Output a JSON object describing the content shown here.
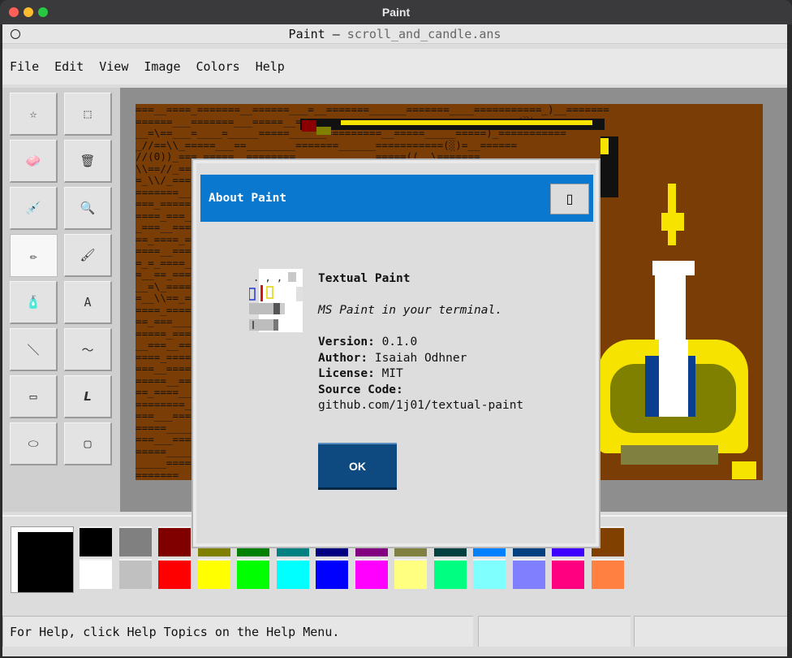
{
  "os_window": {
    "title": "Paint"
  },
  "app": {
    "title_main": "Paint — ",
    "title_file": "scroll_and_candle.ans"
  },
  "menu": [
    "File",
    "Edit",
    "View",
    "Image",
    "Colors",
    "Help"
  ],
  "tools": [
    {
      "name": "free-form-select",
      "glyph": "☆"
    },
    {
      "name": "rect-select",
      "glyph": "⬚"
    },
    {
      "name": "eraser",
      "glyph": "🧼"
    },
    {
      "name": "fill-bucket",
      "glyph": "🗑"
    },
    {
      "name": "pick-color",
      "glyph": "💉"
    },
    {
      "name": "magnifier",
      "glyph": "🔍"
    },
    {
      "name": "pencil",
      "glyph": "✏"
    },
    {
      "name": "brush",
      "glyph": "🖌"
    },
    {
      "name": "airbrush",
      "glyph": "🧴"
    },
    {
      "name": "text",
      "glyph": "A"
    },
    {
      "name": "line",
      "glyph": "＼"
    },
    {
      "name": "curve",
      "glyph": "～"
    },
    {
      "name": "rectangle",
      "glyph": "▭"
    },
    {
      "name": "polygon",
      "glyph": "𝙇"
    },
    {
      "name": "ellipse",
      "glyph": "⬭"
    },
    {
      "name": "rounded-rectangle",
      "glyph": "▢"
    }
  ],
  "palette": {
    "top": [
      "#000000",
      "#808080",
      "#800000",
      "#808000",
      "#008000",
      "#008080",
      "#000080",
      "#800080",
      "#808040",
      "#004040",
      "#0080ff",
      "#004080",
      "#4000ff",
      "#804000"
    ],
    "bottom": [
      "#ffffff",
      "#c0c0c0",
      "#ff0000",
      "#ffff00",
      "#00ff00",
      "#00ffff",
      "#0000ff",
      "#ff00ff",
      "#ffff80",
      "#00ff80",
      "#80ffff",
      "#8080ff",
      "#ff0080",
      "#ff8040"
    ],
    "foreground": "#000000",
    "background": "#ffffff"
  },
  "canvas": {
    "rows": [
      "===__====_=======__======___=__=======______=======____===========_)__=======",
      "======___=======___=====__=====____======____======___________(░)=========",
      "__=\\==___=____=_____=====______=========__=====_____=====)_===========",
      "_//==\\\\_=====___==________=======______===========(░)=__======",
      "//(0))_===_=====__========_____________=====((__\\=======",
      "\\\\==//_=====___===______=====___=========____=\\__=(_))_==_====",
      "=_\\\\/_===__=====_________=======_______===___==(=_)_==_===",
      "=======__=====______======___========______=====__==___\\====",
      "===_=====___=======_____======____=======_=====____=_==_==",
      "====_===___=====_____=====___======___===____===___=======",
      "_===__====_=====______======___========_____===)))=======",
      "==_====_=====____======____======____======__===)))_=====",
      "====__====__=====___=======____======___=___((_\\))///_____",
      "=_=_====___======____======___=======____===___=_/__======",
      "=__==_===__=====______======____=======___=____))))_=====",
      "__=\\_=====_=======_____======____=======____=______=====",
      "=__\\\\==_====___=======_____=====___======___=____======",
      "====_=====__=====____======___=======___=_____=======",
      "==_===____=======______=======____======___=_____=====",
      "=====_====____======_____======____=======___=====",
      "__===__=====______=====_____======____======______",
      "====_=====___======_____=====____======___==",
      "===__=====____======_____=======____=====___",
      "=====__=====___=======_____======____=======_",
      "==_====______=====______=======_____====___==",
      "========_______========_______========_______==",
      "===___=====____======______======____=====_____",
      "=====_______=======_____======___======___==",
      "===___====_______=====_______======____=====",
      "=====____======______=======_______=====__===",
      "_____=======_______======_____=======____=====",
      "=======____=====______======______======__==="
    ]
  },
  "dialog": {
    "title": "About Paint",
    "close_glyph": "▯",
    "app_name": "Textual Paint",
    "tagline": "MS Paint in your terminal.",
    "version_label": "Version:",
    "version_value": "0.1.0",
    "author_label": "Author:",
    "author_value": "Isaiah Odhner",
    "license_label": "License:",
    "license_value": "MIT",
    "source_label": "Source Code:",
    "source_value": "github.com/1j01/textual-paint",
    "ok_label": "OK"
  },
  "status": {
    "help_text": "For Help, click Help Topics on the Help Menu.",
    "coords": "",
    "size": ""
  }
}
